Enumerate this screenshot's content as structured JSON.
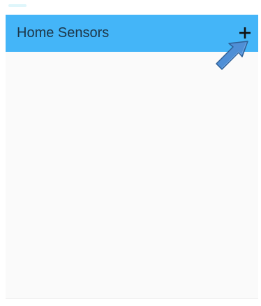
{
  "app_bar": {
    "title": "Home Sensors",
    "action_icon": "plus-icon",
    "background_color": "#44b5f8"
  },
  "annotation": {
    "icon": "pointer-arrow-icon",
    "color": "#4f8fd6"
  },
  "content": {
    "background_color": "#fafafa"
  }
}
